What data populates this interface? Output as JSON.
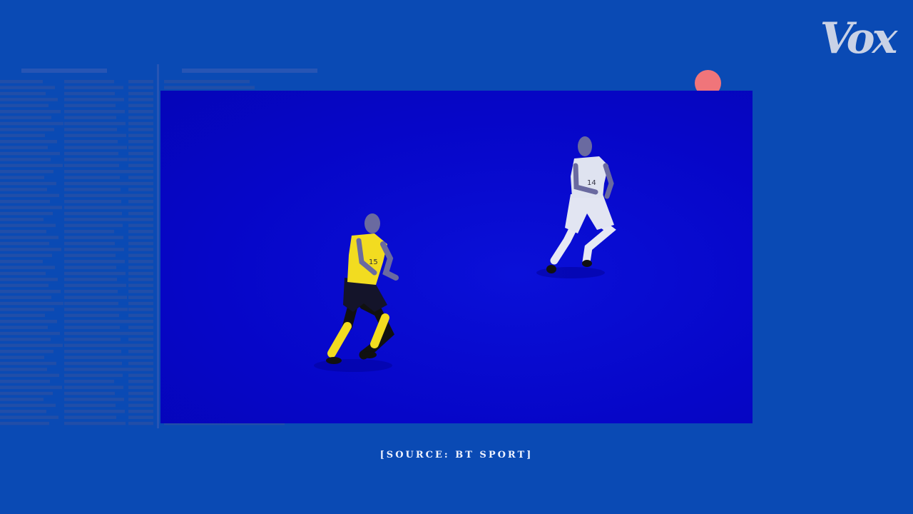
{
  "logo": {
    "text": "Vox"
  },
  "caption": {
    "text": "[SOURCE: BT SPORT]"
  },
  "players": [
    {
      "number": "15",
      "kit": "yellow"
    },
    {
      "number": "14",
      "kit": "white"
    }
  ],
  "colors": {
    "background": "#0a4ab4",
    "video": "#0606c8",
    "record_dot": "#f0757a",
    "yellow_kit": "#f2dc20",
    "white_kit": "#dfe3f0"
  }
}
